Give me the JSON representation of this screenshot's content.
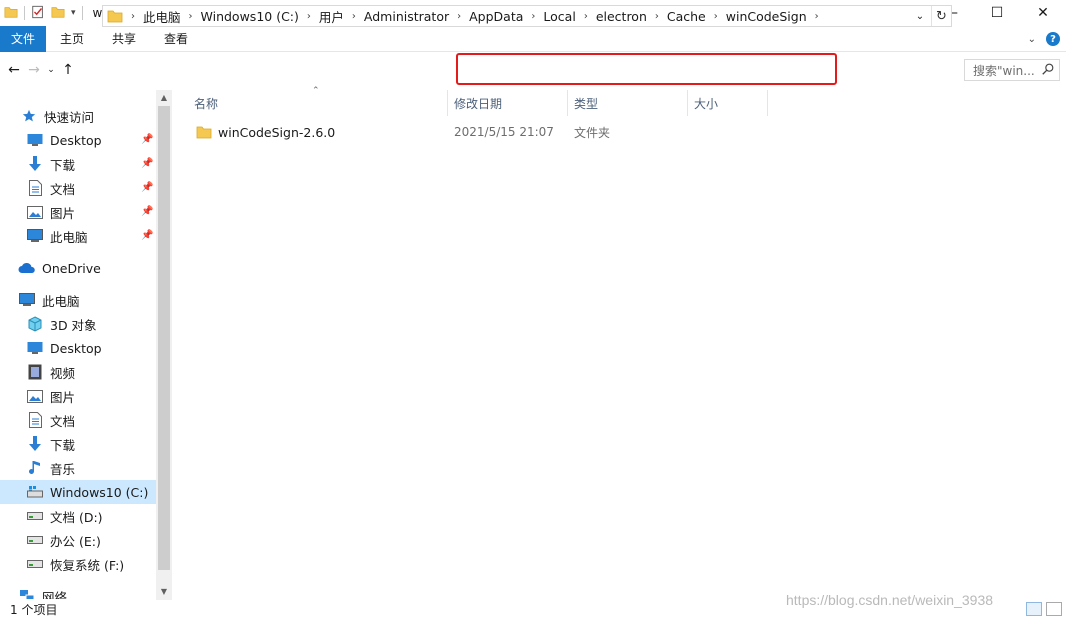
{
  "window": {
    "title": "winCodeSign",
    "minimize": "—",
    "maximize": "☐",
    "close": "✕"
  },
  "ribbon": {
    "tabs": [
      "文件",
      "主页",
      "共享",
      "查看"
    ]
  },
  "address": {
    "crumbs": [
      "此电脑",
      "Windows10 (C:)",
      "用户",
      "Administrator",
      "AppData",
      "Local",
      "electron",
      "Cache",
      "winCodeSign"
    ]
  },
  "search": {
    "placeholder": "搜索\"win..."
  },
  "nav": {
    "quick_access": "快速访问",
    "quick_items": [
      "Desktop",
      "下载",
      "文档",
      "图片",
      "此电脑"
    ],
    "onedrive": "OneDrive",
    "this_pc": "此电脑",
    "pc_items": [
      "3D 对象",
      "Desktop",
      "视频",
      "图片",
      "文档",
      "下载",
      "音乐",
      "Windows10 (C:)",
      "文档 (D:)",
      "办公 (E:)",
      "恢复系统 (F:)"
    ],
    "network": "网络"
  },
  "columns": [
    "名称",
    "修改日期",
    "类型",
    "大小"
  ],
  "files": [
    {
      "name": "winCodeSign-2.6.0",
      "date": "2021/5/15 21:07",
      "type": "文件夹"
    }
  ],
  "status": {
    "count": "1 个项目"
  },
  "watermark": "https://blog.csdn.net/weixin_3938",
  "colors": {
    "accent": "#1979ca",
    "highlight_box": "#e51b1b",
    "selected": "#cce8ff",
    "folder": "#f5c951"
  }
}
